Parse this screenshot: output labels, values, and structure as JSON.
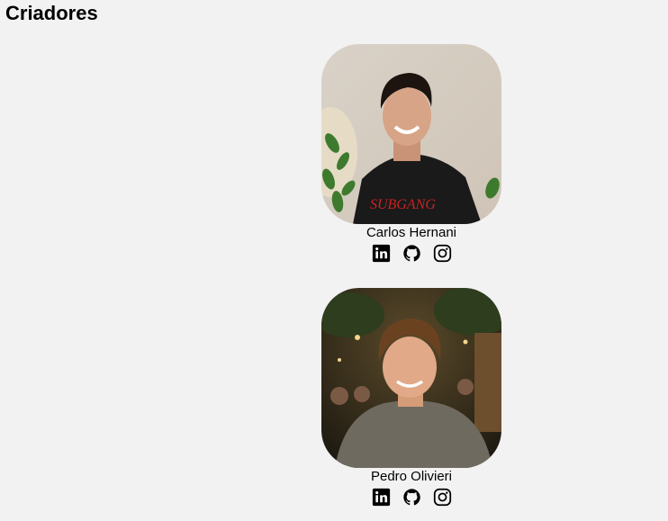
{
  "header": {
    "title": "Criadores"
  },
  "creators": [
    {
      "name": "Carlos Hernani",
      "photo_icon": "person-photo",
      "socials": [
        "linkedin-icon",
        "github-icon",
        "instagram-icon"
      ]
    },
    {
      "name": "Pedro Olivieri",
      "photo_icon": "person-photo",
      "socials": [
        "linkedin-icon",
        "github-icon",
        "instagram-icon"
      ]
    }
  ]
}
